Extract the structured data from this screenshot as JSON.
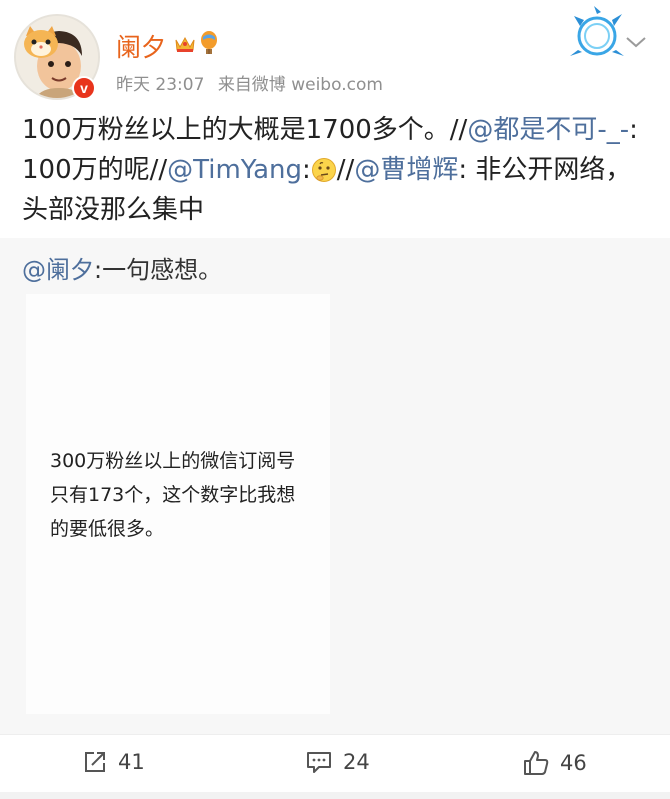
{
  "post": {
    "username": "阑夕",
    "time": "昨天 23:07",
    "source": "来自微博 weibo.com",
    "verified_mark": "v",
    "text_segments": [
      {
        "text": "100万粉丝以上的大概是1700多个。//",
        "type": "text"
      },
      {
        "text": "@都是不可-_-",
        "type": "mention"
      },
      {
        "text": ": 100万的呢//",
        "type": "text"
      },
      {
        "text": "@TimYang",
        "type": "mention"
      },
      {
        "text": ":",
        "type": "text"
      },
      {
        "text": "//",
        "type": "text"
      },
      {
        "text": "@曹增辉",
        "type": "mention"
      },
      {
        "text": ": 非公开网络，头部没那么集中",
        "type": "text"
      }
    ]
  },
  "repost": {
    "mention": "@阑夕",
    "text": ":一句感想。",
    "image_text": "300万粉丝以上的微信订阅号只有173个，这个数字比我想的要低很多。"
  },
  "actions": {
    "repost_count": "41",
    "comment_count": "24",
    "like_count": "46"
  },
  "colors": {
    "username": "#e8641c",
    "mention": "#4e6f9c",
    "meta": "#8f8f8f",
    "repost_bg": "#f7f7f7"
  },
  "icons": [
    "avatar",
    "cat-badge-icon",
    "verified-icon",
    "crown-icon",
    "balloon-icon",
    "decoration-icon",
    "chevron-down-icon",
    "thinking-emoji-icon",
    "repost-icon",
    "comment-icon",
    "like-icon"
  ]
}
